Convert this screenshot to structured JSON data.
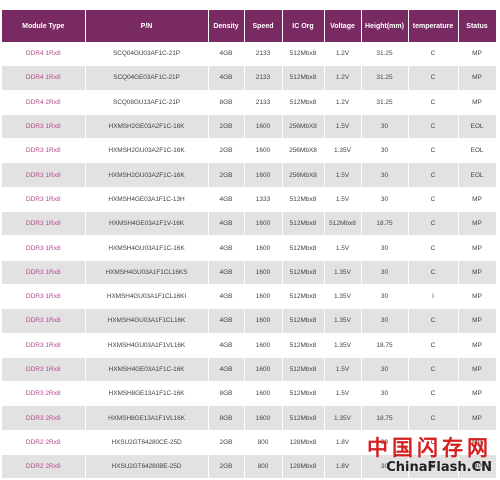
{
  "table": {
    "headers": [
      "Module Type",
      "P/N",
      "Density",
      "Speed",
      "IC Org",
      "Voltage",
      "Height(mm)",
      "temperature",
      "Status"
    ],
    "rows": [
      [
        "DDR4 1Rx8",
        "SCQ04GU03AF1C-21P",
        "4GB",
        "2133",
        "512Mbx8",
        "1.2V",
        "31.25",
        "C",
        "MP"
      ],
      [
        "DDR4 1Rx8",
        "SCQ04GE03AF1C-21P",
        "4GB",
        "2133",
        "512Mbx8",
        "1.2V",
        "31.25",
        "C",
        "MP"
      ],
      [
        "DDR4 2Rx8",
        "SCQ08GU13AF1C-21P",
        "8GB",
        "2133",
        "512Mbx8",
        "1.2V",
        "31.25",
        "C",
        "MP"
      ],
      [
        "DDR3 1Rx8",
        "HXMSH2GE03A2F1C-16K",
        "2GB",
        "1600",
        "256MbX8",
        "1.5V",
        "30",
        "C",
        "EOL"
      ],
      [
        "DDR3 1Rx8",
        "HXMSH2GU03A2F1C-16K",
        "2GB",
        "1600",
        "256MbX8",
        "1.35V",
        "30",
        "C",
        "EOL"
      ],
      [
        "DDR3 1Rx8",
        "HXMSH2GU03A2F1C-16K",
        "2GB",
        "1600",
        "256MbX8",
        "1.5V",
        "30",
        "C",
        "EOL"
      ],
      [
        "DDR3 1Rx8",
        "HXMSH4GE03A1F1C-13H",
        "4GB",
        "1333",
        "512Mbx8",
        "1.5V",
        "30",
        "C",
        "MP"
      ],
      [
        "DDR3 1Rx8",
        "HXMSH4GE03A1F1V-16K",
        "4GB",
        "1600",
        "512Mbx8",
        "512Mbx8",
        "18.75",
        "C",
        "MP"
      ],
      [
        "DDR3 1Rx8",
        "HXMSH4GU03A1F1C-16K",
        "4GB",
        "1600",
        "512Mbx8",
        "1.5V",
        "30",
        "C",
        "MP"
      ],
      [
        "DDR3 1Rx8",
        "HXMSH4GU03A1F1CL16KS",
        "4GB",
        "1600",
        "512Mbx8",
        "1.35V",
        "30",
        "C",
        "MP"
      ],
      [
        "DDR3 1Rx8",
        "HXMSH4GU03A1F1CL16KI",
        "4GB",
        "1600",
        "512Mbx8",
        "1.35V",
        "30",
        "I",
        "MP"
      ],
      [
        "DDR3 1Rx8",
        "HXMSH4GU03A1F1CL16K",
        "4GB",
        "1600",
        "512Mbx8",
        "1.35V",
        "30",
        "C",
        "MP"
      ],
      [
        "DDR3 1Rx8",
        "HXMSH4GU03A1F1VL16K",
        "4GB",
        "1600",
        "512Mbx8",
        "1.35V",
        "18.75",
        "C",
        "MP"
      ],
      [
        "DDR3 1Rx8",
        "HXMSH4GE03A1F1C-16K",
        "4GB",
        "1600",
        "512Mbx8",
        "1.5V",
        "30",
        "C",
        "MP"
      ],
      [
        "DDR3 2Rx8",
        "HXMSH8GE13A1F1C-16K",
        "8GB",
        "1600",
        "512Mbx8",
        "1.5V",
        "30",
        "C",
        "MP"
      ],
      [
        "DDR3 2Rx8",
        "HXMSH8GE13A1F1VL16K",
        "8GB",
        "1600",
        "512Mbx8",
        "1.35V",
        "18.75",
        "C",
        "MP"
      ],
      [
        "DDR2 2Rx8",
        "HXSU2GT64280CE-25D",
        "2GB",
        "800",
        "128Mbx8",
        "1.8V",
        "30",
        "C",
        "MP"
      ],
      [
        "DDR2 2Rx8",
        "HXSU2GT64280BE-25D",
        "2GB",
        "800",
        "128Mbx8",
        "1.8V",
        "30",
        "C",
        "MP"
      ]
    ]
  },
  "watermark": {
    "cn_text": "中国闪存网",
    "en_text": "ChinaFlash.CN"
  },
  "colors": {
    "header_bg": "#7a2a63",
    "module_text": "#b14a8e",
    "row_stripe": "#e2e2e2",
    "watermark_red": "#d42020"
  }
}
